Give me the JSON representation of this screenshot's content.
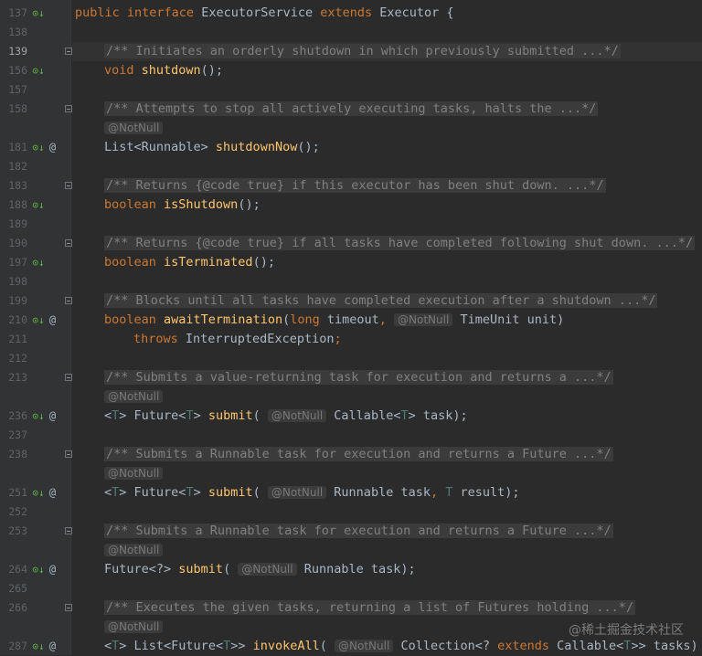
{
  "editor": {
    "lines": [
      {
        "n": "137",
        "icons": [
          "impl"
        ],
        "indent": 0,
        "tokens": [
          [
            "kw",
            "public "
          ],
          [
            "kw",
            "interface "
          ],
          [
            "t",
            "ExecutorService "
          ],
          [
            "kw",
            "extends "
          ],
          [
            "t",
            "Executor {"
          ]
        ]
      },
      {
        "n": "138",
        "icons": [],
        "indent": 0,
        "tokens": []
      },
      {
        "n": "139",
        "icons": [],
        "fold": true,
        "current": true,
        "indent": 1,
        "tokens": [
          [
            "cm",
            "/** Initiates an orderly shutdown in which previously submitted ...*/"
          ]
        ]
      },
      {
        "n": "156",
        "icons": [
          "impl"
        ],
        "indent": 1,
        "tokens": [
          [
            "kw",
            "void "
          ],
          [
            "fn",
            "shutdown"
          ],
          [
            "t",
            "();"
          ]
        ]
      },
      {
        "n": "157",
        "icons": [],
        "indent": 0,
        "tokens": []
      },
      {
        "n": "158",
        "icons": [],
        "fold": true,
        "indent": 1,
        "tokens": [
          [
            "cm",
            "/** Attempts to stop all actively executing tasks, halts the ...*/"
          ]
        ]
      },
      {
        "n": "",
        "icons": [],
        "indent": 1,
        "tokens": [
          [
            "hint",
            "@NotNull"
          ]
        ]
      },
      {
        "n": "181",
        "icons": [
          "impl",
          "ovr"
        ],
        "indent": 1,
        "tokens": [
          [
            "t",
            "List<Runnable> "
          ],
          [
            "fn",
            "shutdownNow"
          ],
          [
            "t",
            "();"
          ]
        ]
      },
      {
        "n": "182",
        "icons": [],
        "indent": 0,
        "tokens": []
      },
      {
        "n": "183",
        "icons": [],
        "fold": true,
        "indent": 1,
        "tokens": [
          [
            "cm",
            "/** Returns {@code true} if this executor has been shut down. ...*/"
          ]
        ]
      },
      {
        "n": "188",
        "icons": [
          "impl"
        ],
        "indent": 1,
        "tokens": [
          [
            "kw",
            "boolean "
          ],
          [
            "fn",
            "isShutdown"
          ],
          [
            "t",
            "();"
          ]
        ]
      },
      {
        "n": "189",
        "icons": [],
        "indent": 0,
        "tokens": []
      },
      {
        "n": "190",
        "icons": [],
        "fold": true,
        "indent": 1,
        "tokens": [
          [
            "cm",
            "/** Returns {@code true} if all tasks have completed following shut down. ...*/"
          ]
        ]
      },
      {
        "n": "197",
        "icons": [
          "impl"
        ],
        "indent": 1,
        "tokens": [
          [
            "kw",
            "boolean "
          ],
          [
            "fn",
            "isTerminated"
          ],
          [
            "t",
            "();"
          ]
        ]
      },
      {
        "n": "198",
        "icons": [],
        "indent": 0,
        "tokens": []
      },
      {
        "n": "199",
        "icons": [],
        "fold": true,
        "indent": 1,
        "tokens": [
          [
            "cm",
            "/** Blocks until all tasks have completed execution after a shutdown ...*/"
          ]
        ]
      },
      {
        "n": "210",
        "icons": [
          "impl",
          "ovr"
        ],
        "indent": 1,
        "tokens": [
          [
            "kw",
            "boolean "
          ],
          [
            "fn",
            "awaitTermination"
          ],
          [
            "t",
            "("
          ],
          [
            "kw",
            "long "
          ],
          [
            "t",
            "timeout"
          ],
          [
            "kw",
            ", "
          ],
          [
            "hint",
            "@NotNull"
          ],
          [
            "t",
            " TimeUnit unit)"
          ]
        ]
      },
      {
        "n": "211",
        "icons": [],
        "indent": 2,
        "tokens": [
          [
            "kw",
            "throws "
          ],
          [
            "t",
            "InterruptedException"
          ],
          [
            "kw",
            ";"
          ]
        ]
      },
      {
        "n": "212",
        "icons": [],
        "indent": 0,
        "tokens": []
      },
      {
        "n": "213",
        "icons": [],
        "fold": true,
        "indent": 1,
        "tokens": [
          [
            "cm",
            "/** Submits a value-returning task for execution and returns a ...*/"
          ]
        ]
      },
      {
        "n": "",
        "icons": [],
        "indent": 1,
        "tokens": [
          [
            "hint",
            "@NotNull"
          ]
        ]
      },
      {
        "n": "236",
        "icons": [
          "impl",
          "ovr"
        ],
        "indent": 1,
        "tokens": [
          [
            "t",
            "<"
          ],
          [
            "tp",
            "T"
          ],
          [
            "t",
            "> Future<"
          ],
          [
            "tp",
            "T"
          ],
          [
            "t",
            "> "
          ],
          [
            "fn",
            "submit"
          ],
          [
            "t",
            "( "
          ],
          [
            "hint",
            "@NotNull"
          ],
          [
            "t",
            " Callable<"
          ],
          [
            "tp",
            "T"
          ],
          [
            "t",
            "> task);"
          ]
        ]
      },
      {
        "n": "237",
        "icons": [],
        "indent": 0,
        "tokens": []
      },
      {
        "n": "238",
        "icons": [],
        "fold": true,
        "indent": 1,
        "tokens": [
          [
            "cm",
            "/** Submits a Runnable task for execution and returns a Future ...*/"
          ]
        ]
      },
      {
        "n": "",
        "icons": [],
        "indent": 1,
        "tokens": [
          [
            "hint",
            "@NotNull"
          ]
        ]
      },
      {
        "n": "251",
        "icons": [
          "impl",
          "ovr"
        ],
        "indent": 1,
        "tokens": [
          [
            "t",
            "<"
          ],
          [
            "tp",
            "T"
          ],
          [
            "t",
            "> Future<"
          ],
          [
            "tp",
            "T"
          ],
          [
            "t",
            "> "
          ],
          [
            "fn",
            "submit"
          ],
          [
            "t",
            "( "
          ],
          [
            "hint",
            "@NotNull"
          ],
          [
            "t",
            " Runnable task"
          ],
          [
            "kw",
            ", "
          ],
          [
            "tp",
            "T"
          ],
          [
            "t",
            " result);"
          ]
        ]
      },
      {
        "n": "252",
        "icons": [],
        "indent": 0,
        "tokens": []
      },
      {
        "n": "253",
        "icons": [],
        "fold": true,
        "indent": 1,
        "tokens": [
          [
            "cm",
            "/** Submits a Runnable task for execution and returns a Future ...*/"
          ]
        ]
      },
      {
        "n": "",
        "icons": [],
        "indent": 1,
        "tokens": [
          [
            "hint",
            "@NotNull"
          ]
        ]
      },
      {
        "n": "264",
        "icons": [
          "impl",
          "ovr"
        ],
        "indent": 1,
        "tokens": [
          [
            "t",
            "Future<?> "
          ],
          [
            "fn",
            "submit"
          ],
          [
            "t",
            "( "
          ],
          [
            "hint",
            "@NotNull"
          ],
          [
            "t",
            " Runnable task);"
          ]
        ]
      },
      {
        "n": "265",
        "icons": [],
        "indent": 0,
        "tokens": []
      },
      {
        "n": "266",
        "icons": [],
        "fold": true,
        "indent": 1,
        "tokens": [
          [
            "cm",
            "/** Executes the given tasks, returning a list of Futures holding ...*/"
          ]
        ]
      },
      {
        "n": "",
        "icons": [],
        "indent": 1,
        "tokens": [
          [
            "hint",
            "@NotNull"
          ]
        ]
      },
      {
        "n": "287",
        "icons": [
          "impl",
          "ovr"
        ],
        "indent": 1,
        "tokens": [
          [
            "t",
            "<"
          ],
          [
            "tp",
            "T"
          ],
          [
            "t",
            "> List<Future<"
          ],
          [
            "tp",
            "T"
          ],
          [
            "t",
            ">> "
          ],
          [
            "fn",
            "invokeAll"
          ],
          [
            "t",
            "( "
          ],
          [
            "hint",
            "@NotNull"
          ],
          [
            "t",
            " Collection<? "
          ],
          [
            "kw",
            "extends "
          ],
          [
            "t",
            "Callable<"
          ],
          [
            "tp",
            "T"
          ],
          [
            "t",
            ">> tasks)"
          ]
        ]
      }
    ]
  },
  "icons": {
    "impl": "implemented-method-icon",
    "ovr": "annotation-override-icon",
    "fold": "fold-toggle-icon"
  },
  "glyphs": {
    "impl": "⊙↓",
    "ovr": "@"
  },
  "watermark": "@稀土掘金技术社区",
  "colors": {
    "background": "#2b2b2b",
    "gutter": "#313335",
    "keyword": "#cc7832",
    "function": "#ffc66d",
    "type_param": "#507874",
    "comment": "#808080",
    "implemented_icon": "#62b543"
  }
}
